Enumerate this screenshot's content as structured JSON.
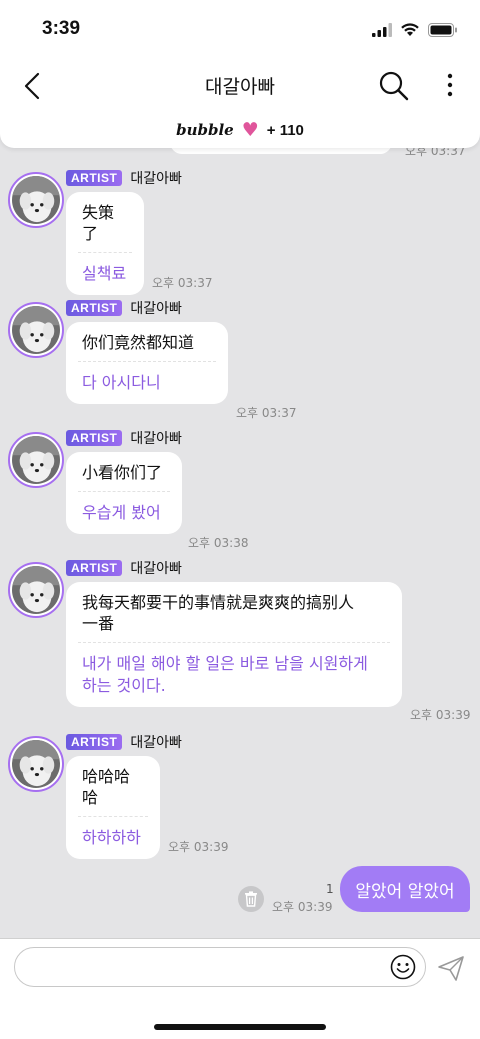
{
  "status_bar": {
    "time": "3:39",
    "icons": [
      "signal-icon",
      "wifi-icon",
      "battery-icon"
    ]
  },
  "nav": {
    "title": "대갈아빠",
    "icons": [
      "back-icon",
      "search-icon",
      "more-icon"
    ]
  },
  "bubble_bar": {
    "brand": "bubble",
    "count": "+ 110",
    "heart_color": "#e0559b"
  },
  "ghost_time": "오후 03:37",
  "messages": [
    {
      "badge": "ARTIST",
      "sender": "대갈아빠",
      "original": "失策了",
      "translation": "실책료",
      "time": "오후 03:37"
    },
    {
      "badge": "ARTIST",
      "sender": "대갈아빠",
      "original": "你们竟然都知道",
      "translation": "다 아시다니",
      "time": "오후 03:37"
    },
    {
      "badge": "ARTIST",
      "sender": "대갈아빠",
      "original": "小看你们了",
      "translation": "우습게 봤어",
      "time": "오후 03:38"
    },
    {
      "badge": "ARTIST",
      "sender": "대갈아빠",
      "original_line1": "我每天都要干的事情就是爽爽的搞别人",
      "original_line2": "一番",
      "translation_line1": "내가 매일 해야 할 일은 바로 남을 시원하게",
      "translation_line2": "하는 것이다.",
      "time": "오후 03:39"
    },
    {
      "badge": "ARTIST",
      "sender": "대갈아빠",
      "original": "哈哈哈哈",
      "translation": "하하하하",
      "time": "오후 03:39"
    }
  ],
  "outgoing": {
    "text": "알았어 알았어",
    "read_count": "1",
    "time": "오후 03:39",
    "bubble_color": "#a27cf5"
  },
  "input": {
    "value": "",
    "placeholder": ""
  },
  "colors": {
    "accent": "#8b5be0",
    "chat_background": "#e4e4e6"
  }
}
